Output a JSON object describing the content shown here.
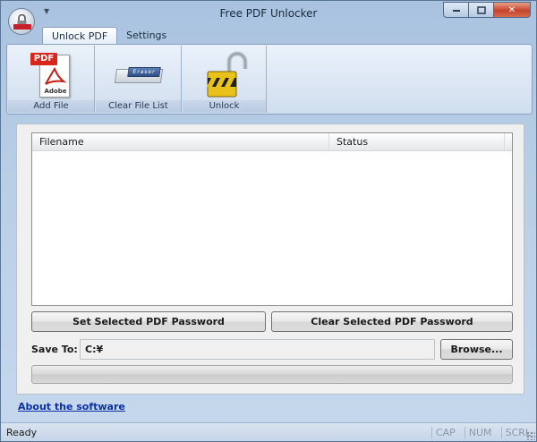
{
  "window": {
    "title": "Free PDF Unlocker",
    "minimize_icon": "minimize-icon",
    "maximize_icon": "maximize-icon",
    "close_icon": "close-icon"
  },
  "tabs": [
    {
      "label": "Unlock PDF",
      "active": true
    },
    {
      "label": "Settings",
      "active": false
    }
  ],
  "ribbon": {
    "buttons": [
      {
        "label": "Add File",
        "icon": "pdf-file-icon"
      },
      {
        "label": "Clear File List",
        "icon": "eraser-icon"
      },
      {
        "label": "Unlock",
        "icon": "unlock-padlock-icon"
      }
    ],
    "pdf_flag": "PDF",
    "pdf_brand": "Adobe",
    "eraser_text": "Eraser"
  },
  "file_list": {
    "columns": [
      "Filename",
      "Status"
    ],
    "rows": []
  },
  "buttons": {
    "set_password": "Set Selected PDF Password",
    "clear_password": "Clear Selected PDF Password",
    "browse": "Browse..."
  },
  "save_to": {
    "label": "Save To:",
    "value": "C:¥"
  },
  "progress": {
    "fraction": 0.0
  },
  "about_link": "About the software",
  "statusbar": {
    "text": "Ready",
    "indicators": [
      "CAP",
      "NUM",
      "SCRL"
    ]
  },
  "colors": {
    "accent": "#0b2fa4",
    "pdf_red": "#d9261c",
    "lock_gold": "#e8c21a"
  }
}
